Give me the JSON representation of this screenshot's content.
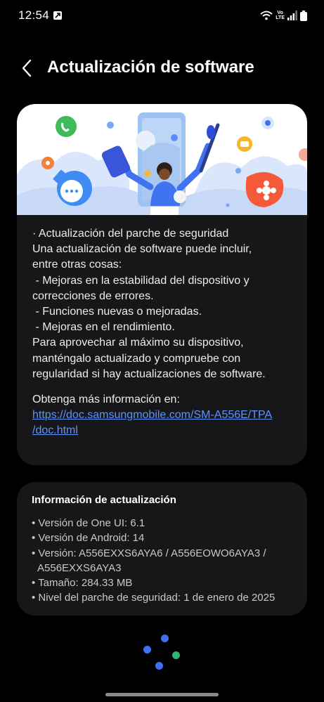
{
  "status_bar": {
    "time": "12:54",
    "network": "LTE",
    "network_top": "Vo",
    "icons": [
      "notification-icon",
      "wifi-icon",
      "volte-icon",
      "signal-icon",
      "battery-icon"
    ]
  },
  "header": {
    "title": "Actualización de software",
    "back_icon": "chevron-left-icon"
  },
  "release_notes": {
    "lines": [
      "· Actualización del parche de seguridad",
      "Una actualización de software puede incluir,",
      "entre otras cosas:",
      " - Mejoras en la estabilidad del dispositivo y",
      "correcciones de errores.",
      " - Funciones nuevas o mejoradas.",
      " - Mejoras en el rendimiento.",
      "Para aprovechar al máximo su dispositivo,",
      "manténgalo actualizado y compruebe con",
      "regularidad si hay actualizaciones de software."
    ],
    "more_info_label": "Obtenga más información en:",
    "link_line1": "https://doc.samsungmobile.com/SM-A556E/TPA",
    "link_line2": "/doc.html"
  },
  "update_info": {
    "title": "Información de actualización",
    "one_ui": "• Versión de One UI: 6.1",
    "android": "• Versión de Android: 14",
    "version_line1": "• Versión: A556EXXS6AYA6 / A556EOWO6AYA3 /",
    "version_line2": "A556EXXS6AYA3",
    "size": "• Tamaño: 284.33 MB",
    "security_patch": "• Nivel del parche de seguridad: 1 de enero de 2025"
  },
  "colors": {
    "background": "#000000",
    "card": "#17171a",
    "link": "#5b94ff",
    "loader_blue": "#3f6ff5",
    "loader_green": "#2bb673"
  }
}
